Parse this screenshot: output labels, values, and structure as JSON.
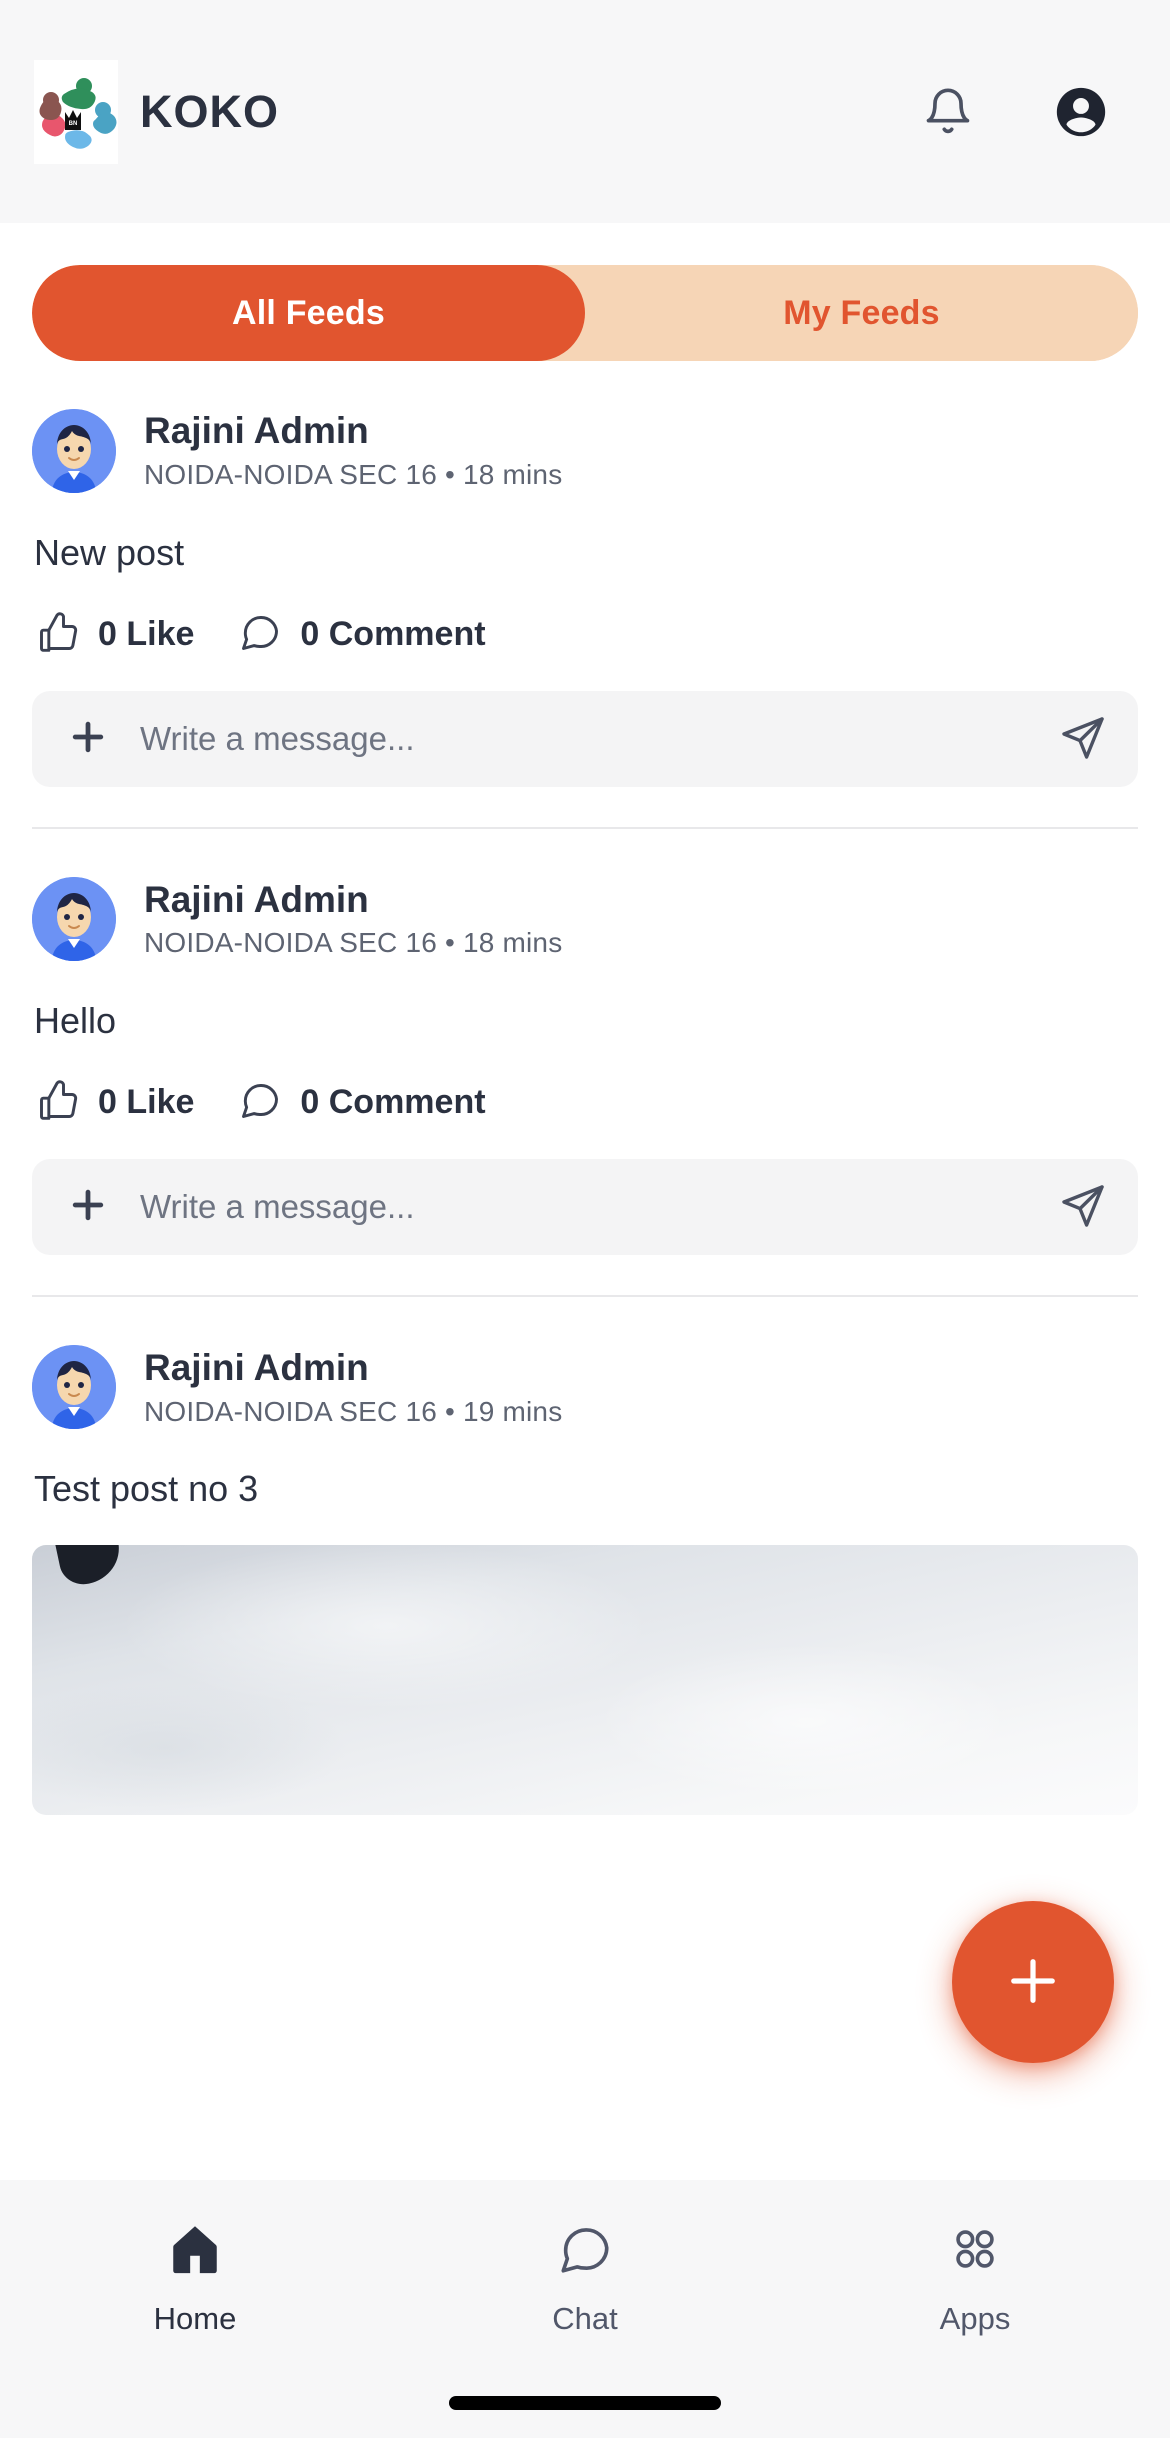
{
  "header": {
    "brand_name": "KOKO",
    "logo_alt": "koko-circle-of-people-logo",
    "notifications_icon": "bell-icon",
    "profile_icon": "account-circle-icon"
  },
  "tabs": [
    {
      "label": "All Feeds",
      "active": true
    },
    {
      "label": "My Feeds",
      "active": false
    }
  ],
  "posts": [
    {
      "author": "Rajini Admin",
      "meta": "NOIDA-NOIDA SEC 16 • 18 mins",
      "text": "New post",
      "like_label": "0 Like",
      "comment_label": "0 Comment",
      "composer_placeholder": "Write a message...",
      "composer_value": "",
      "has_image": false
    },
    {
      "author": "Rajini Admin",
      "meta": "NOIDA-NOIDA SEC 16 • 18 mins",
      "text": "Hello",
      "like_label": "0 Like",
      "comment_label": "0 Comment",
      "composer_placeholder": "Write a message...",
      "composer_value": "",
      "has_image": false
    },
    {
      "author": "Rajini Admin",
      "meta": "NOIDA-NOIDA SEC 16 • 19 mins",
      "text": "Test post no 3",
      "has_image": true
    }
  ],
  "fab": {
    "icon": "plus-icon",
    "label": "+"
  },
  "bottom_nav": [
    {
      "label": "Home",
      "icon": "home-icon",
      "active": true
    },
    {
      "label": "Chat",
      "icon": "chat-bubble-icon",
      "active": false
    },
    {
      "label": "Apps",
      "icon": "apps-grid-icon",
      "active": false
    }
  ],
  "colors": {
    "accent": "#e1552f",
    "accent_light": "#f6d5b6",
    "text_primary": "#2b3140",
    "text_secondary": "#5e6472",
    "surface": "#f7f7f8",
    "field": "#f4f4f5",
    "avatar_bg": "#6c92f4"
  }
}
